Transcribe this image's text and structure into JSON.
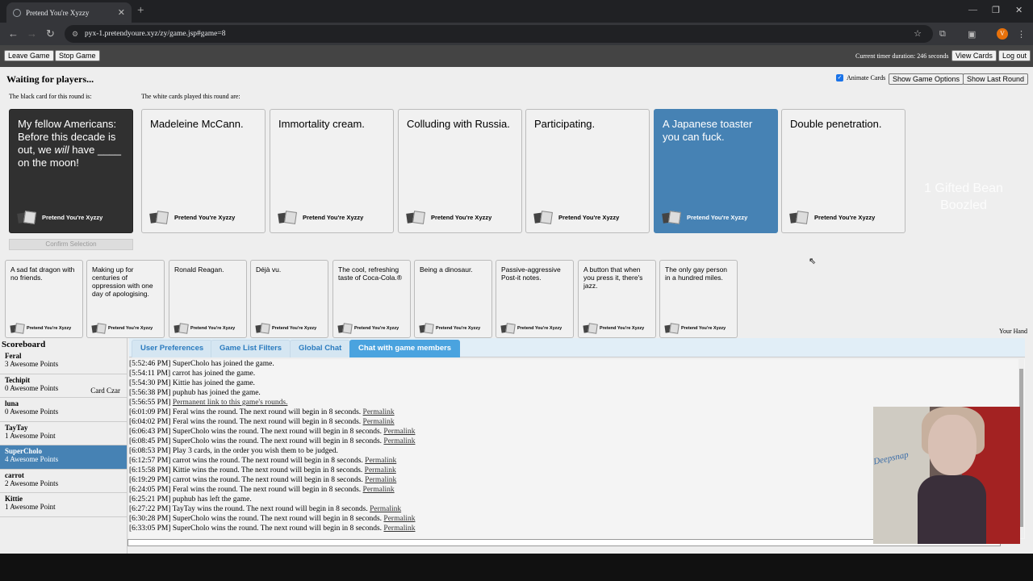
{
  "browser": {
    "tab_title": "Pretend You're Xyzzy",
    "tab_close": "✕",
    "new_tab": "+",
    "url": "pyx-1.pretendyoure.xyz/zy/game.jsp#game=8",
    "avatar_letter": "V"
  },
  "topbar": {
    "leave_label": "Leave Game",
    "stop_label": "Stop Game",
    "timer": "Current timer duration: 246 seconds",
    "view_cards_label": "View Cards",
    "logout_label": "Log out"
  },
  "status": "Waiting for players...",
  "options": {
    "animate_label": "Animate Cards",
    "animate_checked": true,
    "show_options_label": "Show Game Options",
    "show_last_round_label": "Show Last Round"
  },
  "labels": {
    "black_card": "The black card for this round is:",
    "white_cards": "The white cards played this round are:",
    "your_hand": "Your Hand",
    "confirm": "Confirm Selection"
  },
  "black_card": {
    "text_before": "My fellow Americans: Before this decade is out, we ",
    "text_emph": "will",
    "text_after": " have ____ on the moon!",
    "deck": "Pretend You're Xyzzy"
  },
  "played_cards": [
    {
      "text": "Madeleine McCann.",
      "deck": "Pretend You're Xyzzy"
    },
    {
      "text": "Immortality cream.",
      "deck": "Pretend You're Xyzzy"
    },
    {
      "text": "Colluding with Russia.",
      "deck": "Pretend You're Xyzzy"
    },
    {
      "text": "Participating.",
      "deck": "Pretend You're Xyzzy"
    },
    {
      "text": "A Japanese toaster you can fuck.",
      "deck": "Pretend You're Xyzzy",
      "selected": true
    },
    {
      "text": "Double penetration.",
      "deck": "Pretend You're Xyzzy"
    }
  ],
  "ghost_text": "1 Gifted Bean Boozled",
  "hand": [
    {
      "text": "A sad fat dragon with no friends.",
      "deck": "Pretend You're Xyzzy"
    },
    {
      "text": "Making up for centuries of oppression with one day of apologising.",
      "deck": "Pretend You're Xyzzy"
    },
    {
      "text": "Ronald Reagan.",
      "deck": "Pretend You're Xyzzy"
    },
    {
      "text": "Déjà vu.",
      "deck": "Pretend You're Xyzzy"
    },
    {
      "text": "The cool, refreshing taste of Coca-Cola.®",
      "deck": "Pretend You're Xyzzy"
    },
    {
      "text": "Being a dinosaur.",
      "deck": "Pretend You're Xyzzy"
    },
    {
      "text": "Passive-aggressive Post-it notes.",
      "deck": "Pretend You're Xyzzy"
    },
    {
      "text": "A button that when you press it, there's jazz.",
      "deck": "Pretend You're Xyzzy"
    },
    {
      "text": "The only gay person in a hundred miles.",
      "deck": "Pretend You're Xyzzy"
    }
  ],
  "scoreboard": {
    "title": "Scoreboard",
    "players": [
      {
        "name": "Feral",
        "score": "3 Awesome Points",
        "czar": ""
      },
      {
        "name": "Techipit",
        "score": "0 Awesome Points",
        "czar": "Card Czar"
      },
      {
        "name": "luna",
        "score": "0 Awesome Points",
        "czar": ""
      },
      {
        "name": "TayTay",
        "score": "1 Awesome Point",
        "czar": ""
      },
      {
        "name": "SuperCholo",
        "score": "4 Awesome Points",
        "czar": "",
        "active": true
      },
      {
        "name": "carrot",
        "score": "2 Awesome Points",
        "czar": ""
      },
      {
        "name": "Kittie",
        "score": "1 Awesome Point",
        "czar": ""
      }
    ]
  },
  "tabs": [
    "User Preferences",
    "Game List Filters",
    "Global Chat",
    "Chat with game members"
  ],
  "chat": [
    {
      "text": "[5:52:46 PM] SuperCholo has joined the game.",
      "link": ""
    },
    {
      "text": "[5:54:11 PM] carrot has joined the game.",
      "link": ""
    },
    {
      "text": "[5:54:30 PM] Kittie has joined the game.",
      "link": ""
    },
    {
      "text": "[5:56:38 PM] puphub has joined the game.",
      "link": ""
    },
    {
      "text": "[5:56:55 PM] ",
      "link": "Permanent link to this game's rounds."
    },
    {
      "text": "[6:01:09 PM] Feral wins the round. The next round will begin in 8 seconds. ",
      "link": "Permalink"
    },
    {
      "text": "[6:04:02 PM] Feral wins the round. The next round will begin in 8 seconds. ",
      "link": "Permalink"
    },
    {
      "text": "[6:06:43 PM] SuperCholo wins the round. The next round will begin in 8 seconds. ",
      "link": "Permalink"
    },
    {
      "text": "[6:08:45 PM] SuperCholo wins the round. The next round will begin in 8 seconds. ",
      "link": "Permalink"
    },
    {
      "text": "[6:08:53 PM] Play 3 cards, in the order you wish them to be judged.",
      "link": ""
    },
    {
      "text": "[6:12:57 PM] carrot wins the round. The next round will begin in 8 seconds. ",
      "link": "Permalink"
    },
    {
      "text": "[6:15:58 PM] Kittie wins the round. The next round will begin in 8 seconds. ",
      "link": "Permalink"
    },
    {
      "text": "[6:19:29 PM] carrot wins the round. The next round will begin in 8 seconds. ",
      "link": "Permalink"
    },
    {
      "text": "[6:24:05 PM] Feral wins the round. The next round will begin in 8 seconds. ",
      "link": "Permalink"
    },
    {
      "text": "[6:25:21 PM] puphub has left the game.",
      "link": ""
    },
    {
      "text": "[6:27:22 PM] TayTay wins the round. The next round will begin in 8 seconds. ",
      "link": "Permalink"
    },
    {
      "text": "[6:30:28 PM] SuperCholo wins the round. The next round will begin in 8 seconds. ",
      "link": "Permalink"
    },
    {
      "text": "[6:33:05 PM] SuperCholo wins the round. The next round will begin in 8 seconds. ",
      "link": "Permalink"
    }
  ],
  "webcam_sign": "Deepsnap"
}
